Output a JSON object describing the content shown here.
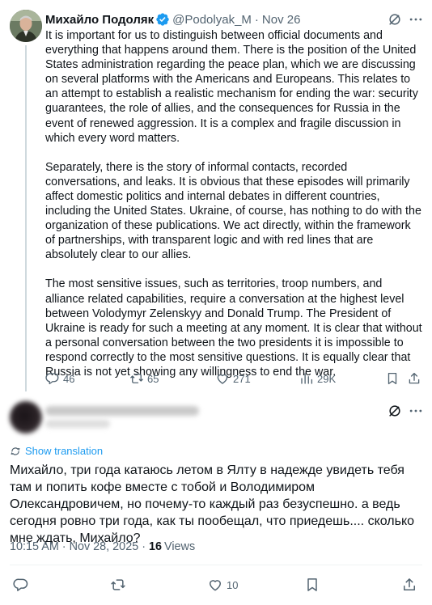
{
  "tweet": {
    "author_name": "Михайло Подоляк",
    "handle": "@Podolyak_M",
    "separator": "·",
    "date": "Nov 26",
    "paragraphs": [
      "It is important for us to distinguish between official documents and everything that happens around them. There is the position of the United States administration regarding the peace plan, which we are discussing on several platforms with the Americans and Europeans. This relates to an attempt to establish a realistic mechanism for ending the war: security guarantees, the role of allies, and the consequences for Russia in the event of renewed aggression. It is a complex and fragile discussion in which every word matters.",
      "Separately, there is the story of informal contacts, recorded conversations, and leaks. It is obvious that these episodes will primarily affect domestic politics and internal debates in different countries, including the United States. Ukraine, of course, has nothing to do with the organization of these publications. We act directly, within the framework of partnerships, with transparent logic and with red lines that are absolutely clear to our allies.",
      "The most sensitive issues, such as territories, troop numbers, and alliance related capabilities, require a conversation at the highest level between Volodymyr Zelenskyy and Donald Trump. The President of Ukraine is ready for such a meeting at any moment. It is clear that without a personal conversation between the two presidents it is impossible to respond correctly to the most sensitive questions. It is equally clear that Russia is not yet showing any willingness to end the war."
    ],
    "actions": {
      "replies": "46",
      "reposts": "65",
      "likes": "271",
      "views": "29K"
    }
  },
  "reply": {
    "show_translation": "Show translation",
    "text": "Михайло, три года катаюсь летом в Ялту в надежде увидеть тебя там и попить кофе вместе с тобой и Володимиром Олександровичем, но почему-то каждый раз безуспешно. а ведь сегодня ровно три года, как ты пообещал, что приедешь.... сколько мне ждать, Михайло?",
    "timestamp": "10:15 AM · Nov 28, 2025 ·",
    "views_count": "16",
    "views_label": "Views",
    "actions": {
      "likes": "10"
    }
  },
  "icons": {
    "verified": "verified-badge-icon",
    "grok": "grok-icon",
    "more": "more-icon",
    "reply": "reply-icon",
    "repost": "repost-icon",
    "like": "heart-icon",
    "views": "views-chart-icon",
    "bookmark": "bookmark-icon",
    "share": "share-icon",
    "translate": "translate-icon"
  },
  "colors": {
    "accent": "#1d9bf0",
    "muted": "#536471",
    "text": "#0f1419",
    "divider": "#eff3f4",
    "thread_line": "#cfd9de"
  }
}
